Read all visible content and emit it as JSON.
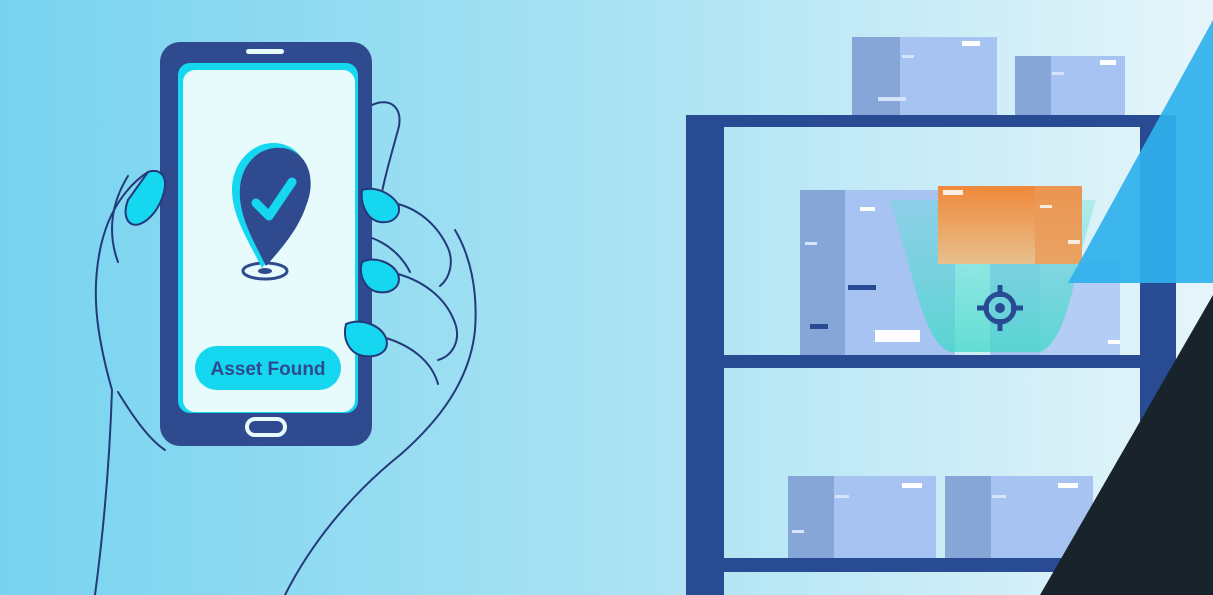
{
  "screen": {
    "status_label": "Asset Found",
    "status_icon": "location-pin-check-icon"
  },
  "shelf": {
    "target_icon": "crosshair-target-icon"
  },
  "colors": {
    "background_left": "#79d4ef",
    "background_right": "#e4f4fa",
    "phone_body": "#2f4a8f",
    "phone_screen": "#e8fbfc",
    "accent_cyan": "#15d8f0",
    "shelf_frame": "#294b93",
    "box_light": "#a6c3f2",
    "box_dark": "#7fa1d5",
    "box_found": "#f08a39",
    "corner_blue": "#2fb1ec",
    "corner_dark": "#18232b"
  }
}
